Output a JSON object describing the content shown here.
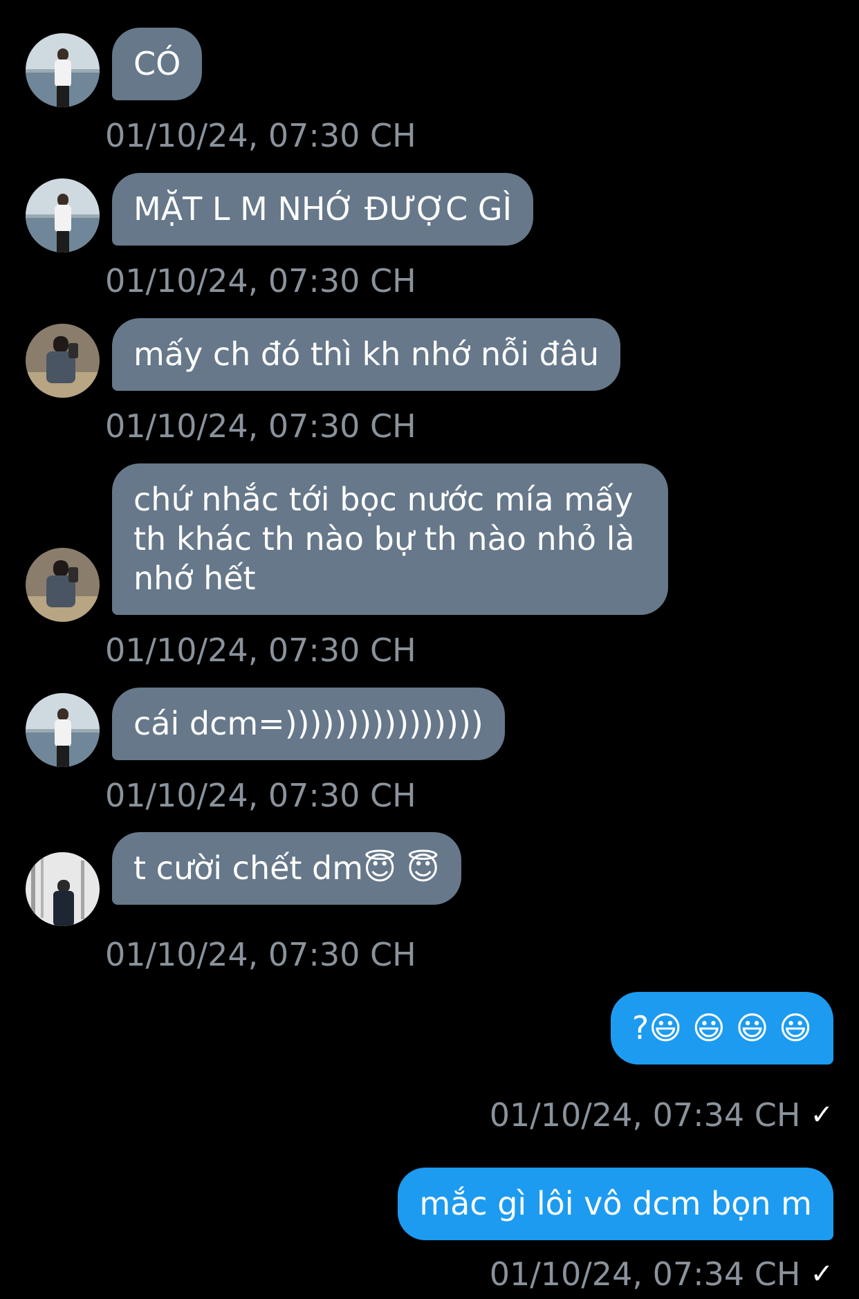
{
  "messages": [
    {
      "text": "CÓ",
      "time": "01/10/24, 07:30 CH"
    },
    {
      "text": "MẶT L M NHỚ ĐƯỢC GÌ",
      "time": "01/10/24, 07:30 CH"
    },
    {
      "text": "mấy ch đó thì kh nhớ nỗi đâu",
      "time": "01/10/24, 07:30 CH"
    },
    {
      "text": "chứ nhắc tới bọc nước mía mấy th khác th nào bự th nào nhỏ là nhớ hết",
      "time": "01/10/24, 07:30 CH"
    },
    {
      "text": "cái dcm=))))))))))))))))",
      "time": "01/10/24, 07:30 CH"
    },
    {
      "text": "t cười chết dm😇 😇",
      "time": "01/10/24, 07:30 CH"
    },
    {
      "text": "?😃 😃 😃 😃",
      "time": "01/10/24, 07:34 CH",
      "status": "✓"
    },
    {
      "text": "mắc gì lôi vô dcm bọn m",
      "time": "01/10/24, 07:34 CH",
      "status": "✓"
    }
  ],
  "colors": {
    "incoming_bubble": "#66788a",
    "outgoing_bubble": "#1d9bf0",
    "timestamp": "#8a939c",
    "background": "#000000"
  },
  "icons": {
    "avatar_a": "avatar-photo-person-by-sea",
    "avatar_b": "avatar-photo-person-selfie",
    "avatar_c": "avatar-photo-person-trees",
    "read_receipt": "checkmark-icon"
  }
}
